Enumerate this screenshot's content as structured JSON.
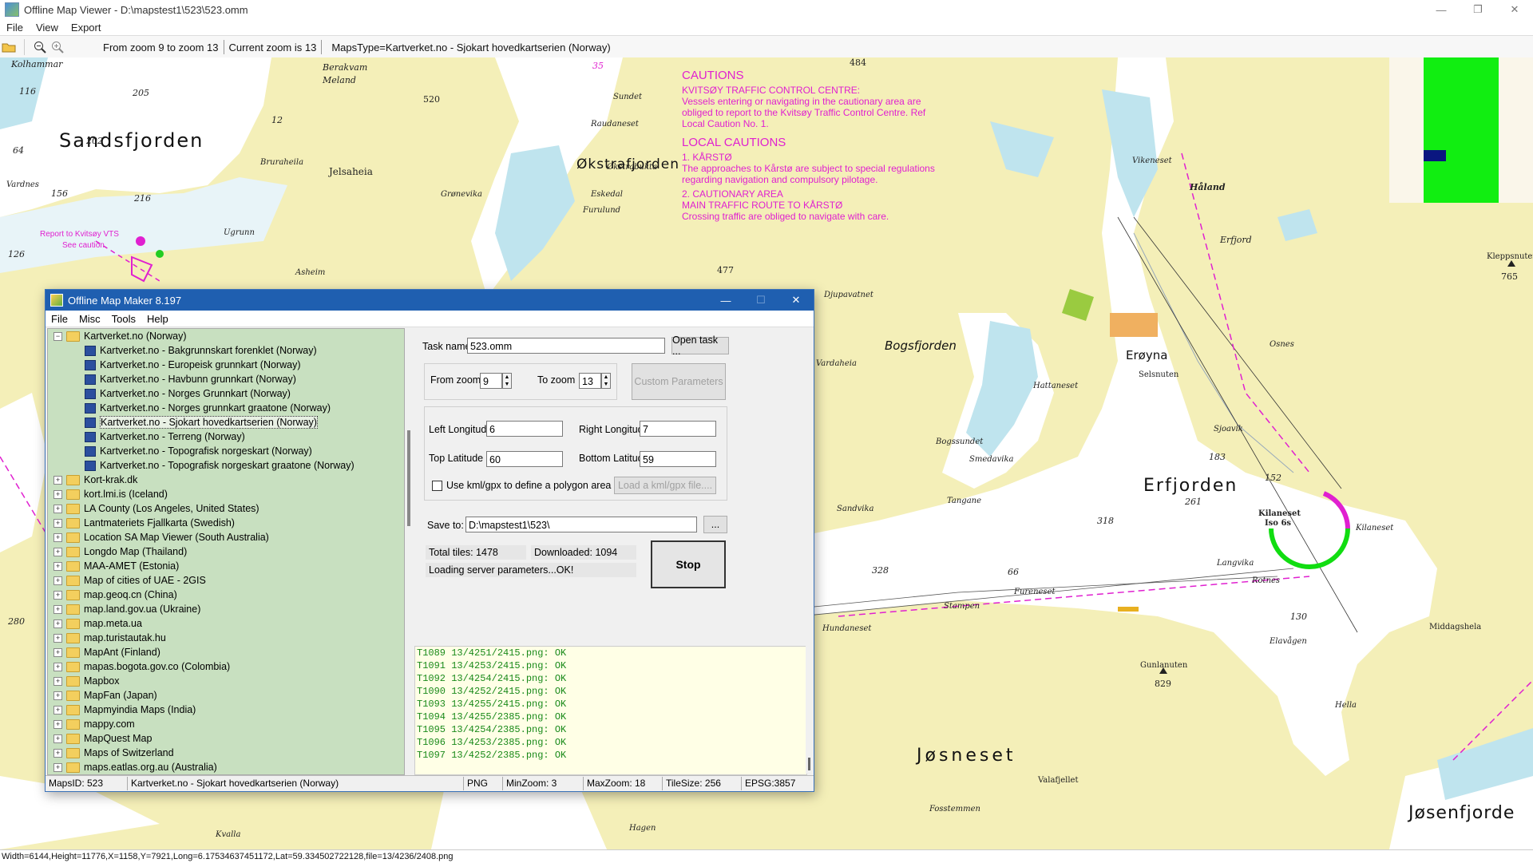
{
  "window": {
    "title": "Offline Map Viewer - D:\\mapstest1\\523\\523.omm",
    "minimize": "—",
    "maximize": "❐",
    "close": "✕"
  },
  "menu": [
    "File",
    "View",
    "Export"
  ],
  "toolbar": {
    "zoom_range": "From zoom 9 to zoom 13",
    "current_zoom": "Current zoom is 13",
    "maps_type": "MapsType=Kartverket.no - Sjokart hovedkartserien (Norway)"
  },
  "map": {
    "labels": {
      "sandsfjorden": "Sandsfjorden",
      "okstrafjorden": "Økstrafjorden",
      "bogsfjorden": "Bogsfjorden",
      "eroyna": "Erøyna",
      "erfjorden": "Erfjorden",
      "josneset": "Jøsneset",
      "josenfjorde": "Jøsenfjorde",
      "jelsaheia": "Jelsaheia",
      "kolhammar": "Kolhammar",
      "sundet": "Sundet",
      "raudaneset": "Raudaneset",
      "okstrabukta": "Økstrabukta",
      "eskedal": "Eskedal",
      "furulund": "Furulund",
      "grjonevika": "Grønevika",
      "vikeneset": "Vikeneset",
      "holand": "Håland",
      "erfjord": "Erfjord",
      "kleppsnuten": "Kleppsnuten",
      "hundaneset": "Hundaneset",
      "sandvika": "Sandvika",
      "sjoavik": "Sjoavik",
      "stampen": "Stampen",
      "fureneset": "Fureneset",
      "langvika": "Langvika",
      "kilaneset": "Kilaneset",
      "rotnes": "Rotnes",
      "elavagen": "Elavågen",
      "middagshela": "Middagshela",
      "gunlanuten": "Gunlanuten",
      "valafjellet": "Valafjellet",
      "fosstemmen": "Fosstemmen",
      "hella": "Hella",
      "osnes": "Osnes",
      "smedavika": "Smedavika",
      "tangane": "Tangane",
      "bogssundet": "Bogssundet",
      "selsnuten": "Selsnuten",
      "hattaneset": "Hattaneset",
      "vardaheia": "Vardaheia",
      "djupavatnet": "Djupavatnet",
      "hagen": "Hagen",
      "kvalla": "Kvalla",
      "ugrunn": "Ugrunn",
      "bruraheila": "Bruraheila",
      "melana": "Meland",
      "berakvam": "Berakvam",
      "asheim": "Asheim",
      "vardnes": "Vardnes",
      "vrr": "Report to Kvitsøy VTS",
      "see_caution": "See caution",
      "kilaneset_light": "Kilaneset",
      "iso": "Iso 6s"
    },
    "cautions": {
      "heading": "CAUTIONS",
      "vts_title": "KVITSØY TRAFFIC CONTROL CENTRE:",
      "vts_text1": "Vessels entering or navigating in the cautionary area are",
      "vts_text2": "obliged to report to the Kvitsøy Traffic Control Centre. Ref",
      "vts_text3": "Local Caution No. 1.",
      "local_heading": "LOCAL CAUTIONS",
      "k1_title": "1. KÅRSTØ",
      "k1_text1": "The approaches to Kårstø are subject to special regulations",
      "k1_text2": "regarding navigation and compulsory pilotage.",
      "k2_title": "2. CAUTIONARY AREA",
      "k2_sub": "MAIN TRAFFIC ROUTE TO KÅRSTØ",
      "k2_text": "Crossing traffic are obliged to navigate with care."
    },
    "depths": [
      "116",
      "205",
      "202",
      "64",
      "156",
      "126",
      "216",
      "520",
      "35",
      "477",
      "484",
      "765",
      "829",
      "261",
      "152",
      "183",
      "318",
      "328",
      "66",
      "280",
      "130",
      "12"
    ]
  },
  "statusbar": "Width=6144,Height=11776,X=1158,Y=7921,Long=6.17534637451172,Lat=59.334502722128,file=13/4236/2408.png",
  "dialog": {
    "title": "Offline Map Maker 8.197",
    "menu": [
      "File",
      "Misc",
      "Tools",
      "Help"
    ],
    "tree_root": "Kartverket.no (Norway)",
    "tree_children": [
      "Kartverket.no - Bakgrunnskart forenklet (Norway)",
      "Kartverket.no - Europeisk grunnkart (Norway)",
      "Kartverket.no - Havbunn grunnkart (Norway)",
      "Kartverket.no - Norges Grunnkart (Norway)",
      "Kartverket.no - Norges grunnkart graatone (Norway)",
      "Kartverket.no - Sjokart hovedkartserien (Norway)",
      "Kartverket.no - Terreng (Norway)",
      "Kartverket.no - Topografisk norgeskart (Norway)",
      "Kartverket.no - Topografisk norgeskart graatone (Norway)"
    ],
    "tree_folders": [
      "Kort-krak.dk",
      "kort.lmi.is (Iceland)",
      "LA County (Los Angeles, United States)",
      "Lantmateriets Fjallkarta (Swedish)",
      "Location SA Map Viewer (South Australia)",
      "Longdo Map (Thailand)",
      "MAA-AMET (Estonia)",
      "Map of cities of UAE - 2GIS",
      "map.geoq.cn (China)",
      "map.land.gov.ua (Ukraine)",
      "map.meta.ua",
      "map.turistautak.hu",
      "MapAnt (Finland)",
      "mapas.bogota.gov.co (Colombia)",
      "Mapbox",
      "MapFan (Japan)",
      "Mapmyindia Maps (India)",
      "mappy.com",
      "MapQuest Map",
      "Maps of Switzerland",
      "maps.eatlas.org.au (Australia)"
    ],
    "task_name_label": "Task name",
    "task_name": "523.omm",
    "open_task": "Open task ...",
    "from_zoom_label": "From zoom",
    "from_zoom": "9",
    "to_zoom_label": "To zoom",
    "to_zoom": "13",
    "custom_params": "Custom Parameters",
    "left_lon_label": "Left Longitude",
    "left_lon": "6",
    "right_lon_label": "Right Longitude",
    "right_lon": "7",
    "top_lat_label": "Top Latitude",
    "top_lat": "60",
    "bottom_lat_label": "Bottom Latitude",
    "bottom_lat": "59",
    "kml_label": "Use kml/gpx to define a polygon area",
    "load_kml": "Load a kml/gpx file....",
    "save_to_label": "Save to:",
    "save_to": "D:\\mapstest1\\523\\",
    "browse": "...",
    "total_tiles": "Total tiles: 1478",
    "downloaded": "Downloaded: 1094",
    "status_msg": "Loading server parameters...OK!",
    "stop": "Stop",
    "log": [
      "T1089 13/4251/2415.png: OK",
      "T1091 13/4253/2415.png: OK",
      "T1092 13/4254/2415.png: OK",
      "T1090 13/4252/2415.png: OK",
      "T1093 13/4255/2415.png: OK",
      "T1094 13/4255/2385.png: OK",
      "T1095 13/4254/2385.png: OK",
      "T1096 13/4253/2385.png: OK",
      "T1097 13/4252/2385.png: OK"
    ],
    "status": {
      "mapsid": "MapsID: 523",
      "mapname": "Kartverket.no - Sjokart hovedkartserien (Norway)",
      "format": "PNG",
      "minzoom": "MinZoom: 3",
      "maxzoom": "MaxZoom: 18",
      "tilesize": "TileSize: 256",
      "epsg": "EPSG:3857"
    }
  },
  "colors": {
    "land": "#f4efb8",
    "sea": "#ffffff",
    "shallow": "#bfe4ee",
    "magenta": "#e020d0",
    "dialog_title": "#1f5fb0",
    "tree_bg": "#c8e0c0",
    "log_text": "#1a8a1a"
  }
}
